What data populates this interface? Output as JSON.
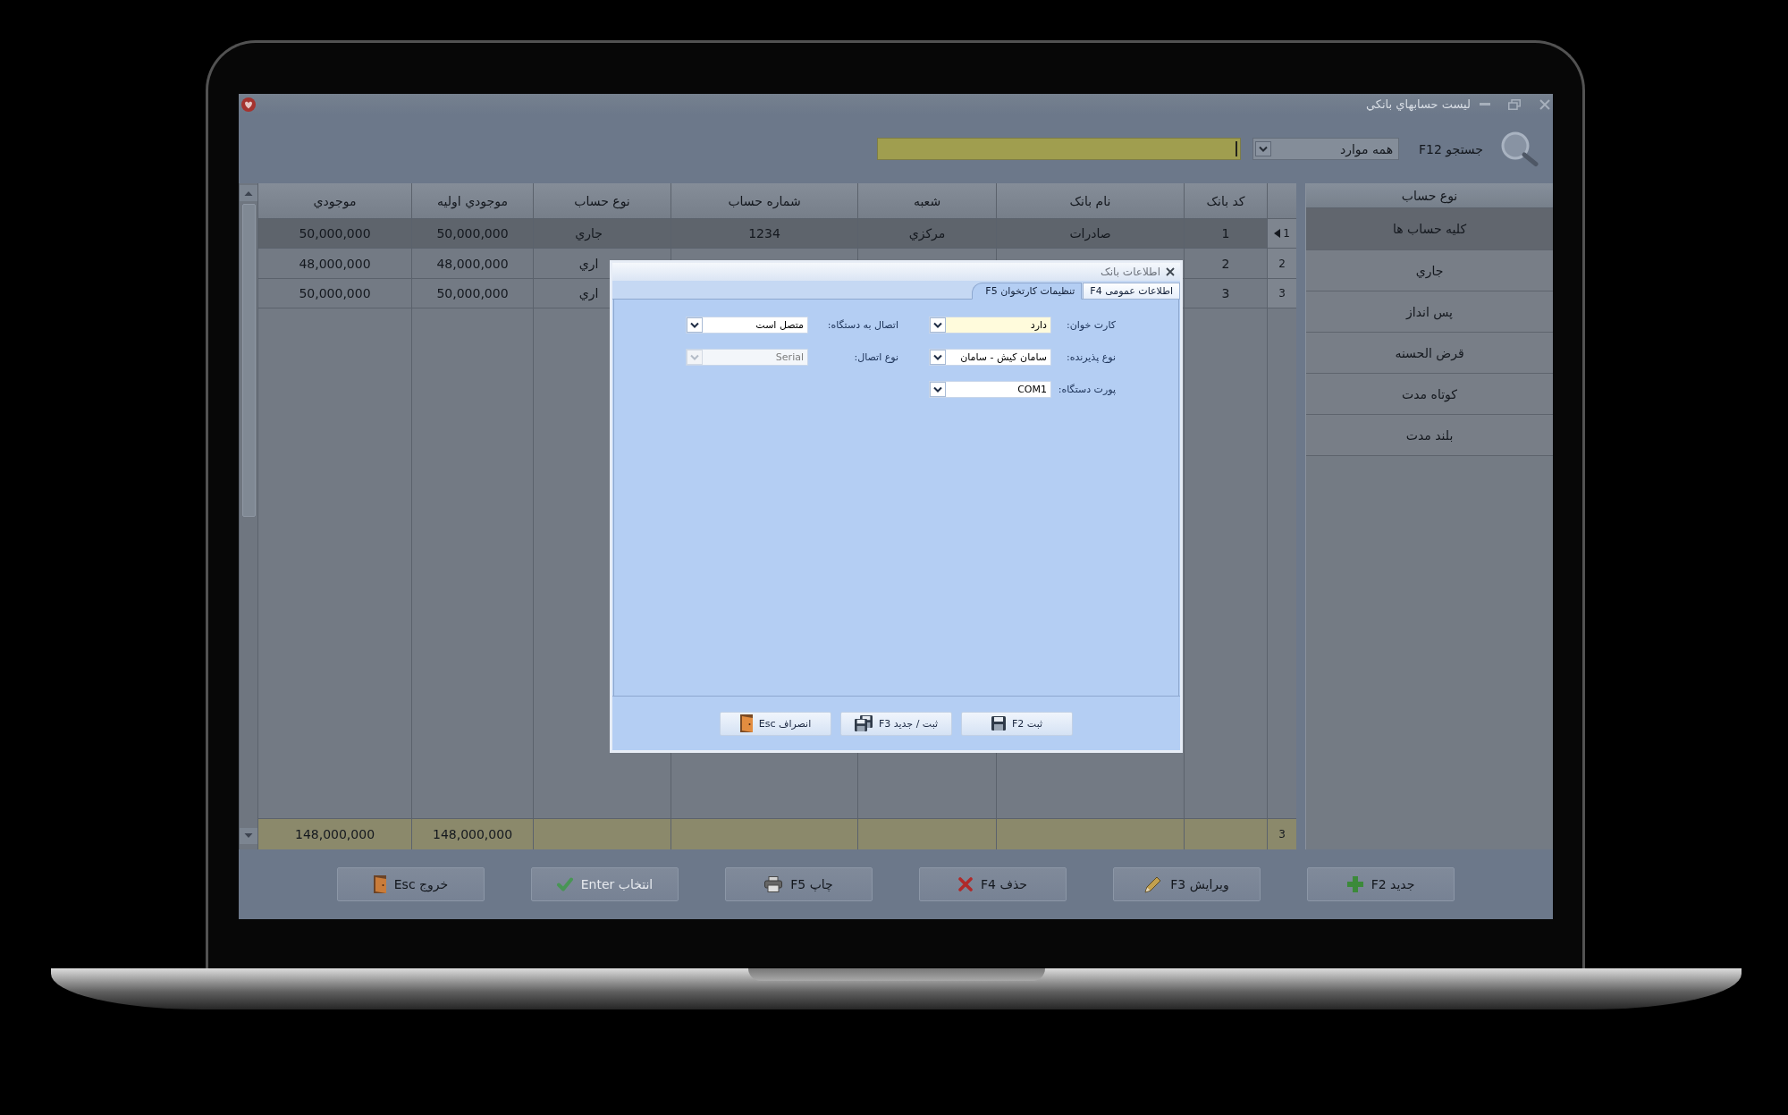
{
  "window": {
    "title": "لیست حسابهاي بانکي"
  },
  "search": {
    "label": "جستجو F12",
    "scope": "همه موارد"
  },
  "sidebar": {
    "title": "نوع حساب",
    "items": [
      {
        "label": "کلیه حساب ها",
        "selected": true
      },
      {
        "label": "جاري",
        "selected": false
      },
      {
        "label": "پس انداز",
        "selected": false
      },
      {
        "label": "قرض الحسنه",
        "selected": false
      },
      {
        "label": "کوتاه مدت",
        "selected": false
      },
      {
        "label": "بلند مدت",
        "selected": false
      }
    ]
  },
  "table": {
    "columns": [
      "کد بانک",
      "نام بانک",
      "شعبه",
      "شماره حساب",
      "نوع حساب",
      "موجودي اوليه",
      "موجودي"
    ],
    "rows": [
      {
        "number": "1",
        "selected": true,
        "cells": [
          "1",
          "صادرات",
          "مرکزي",
          "1234",
          "جاري",
          "50,000,000",
          "50,000,000"
        ]
      },
      {
        "number": "2",
        "selected": false,
        "cells": [
          "2",
          null,
          null,
          null,
          "اري",
          "48,000,000",
          "48,000,000"
        ]
      },
      {
        "number": "3",
        "selected": false,
        "cells": [
          "3",
          null,
          null,
          null,
          "اري",
          "50,000,000",
          "50,000,000"
        ]
      }
    ],
    "footer": {
      "count": "3",
      "cells": [
        null,
        null,
        null,
        null,
        null,
        "148,000,000",
        "148,000,000"
      ]
    }
  },
  "buttons": [
    {
      "kind": "new",
      "label": "جدید F2",
      "disabled": false
    },
    {
      "kind": "edit",
      "label": "ویرایش F3",
      "disabled": false
    },
    {
      "kind": "delete",
      "label": "حذف F4",
      "disabled": false
    },
    {
      "kind": "print",
      "label": "چاپ F5",
      "disabled": false
    },
    {
      "kind": "select",
      "label": "انتخاب Enter",
      "disabled": true
    },
    {
      "kind": "exit",
      "label": "خروج Esc",
      "disabled": false
    }
  ],
  "dialog": {
    "title": "اطلاعات بانک",
    "tabs": [
      {
        "label": "اطلاعات عمومی F4",
        "selected": false
      },
      {
        "label": "تنظیمات کارتخوان F5",
        "selected": true
      }
    ],
    "field_columns": [
      [
        {
          "label": "کارت خوان:",
          "value": "دارد",
          "focused": true,
          "disabled": false
        },
        {
          "label": "نوع پذیرنده:",
          "value": "سامان کیش - سامان",
          "focused": false,
          "disabled": false
        },
        {
          "label": "پورت دستگاه:",
          "value": "COM1",
          "focused": false,
          "disabled": false
        }
      ],
      [
        {
          "label": "اتصال به دستگاه:",
          "value": "متصل است",
          "focused": false,
          "disabled": false
        },
        {
          "label": "نوع اتصال:",
          "value": "Serial",
          "focused": false,
          "disabled": true
        }
      ]
    ],
    "buttons": [
      {
        "kind": "save",
        "label": "ثبت F2"
      },
      {
        "kind": "savenew",
        "label": "ثبت / جدید F3"
      },
      {
        "kind": "cancel",
        "label": "انصراف Esc"
      }
    ]
  }
}
